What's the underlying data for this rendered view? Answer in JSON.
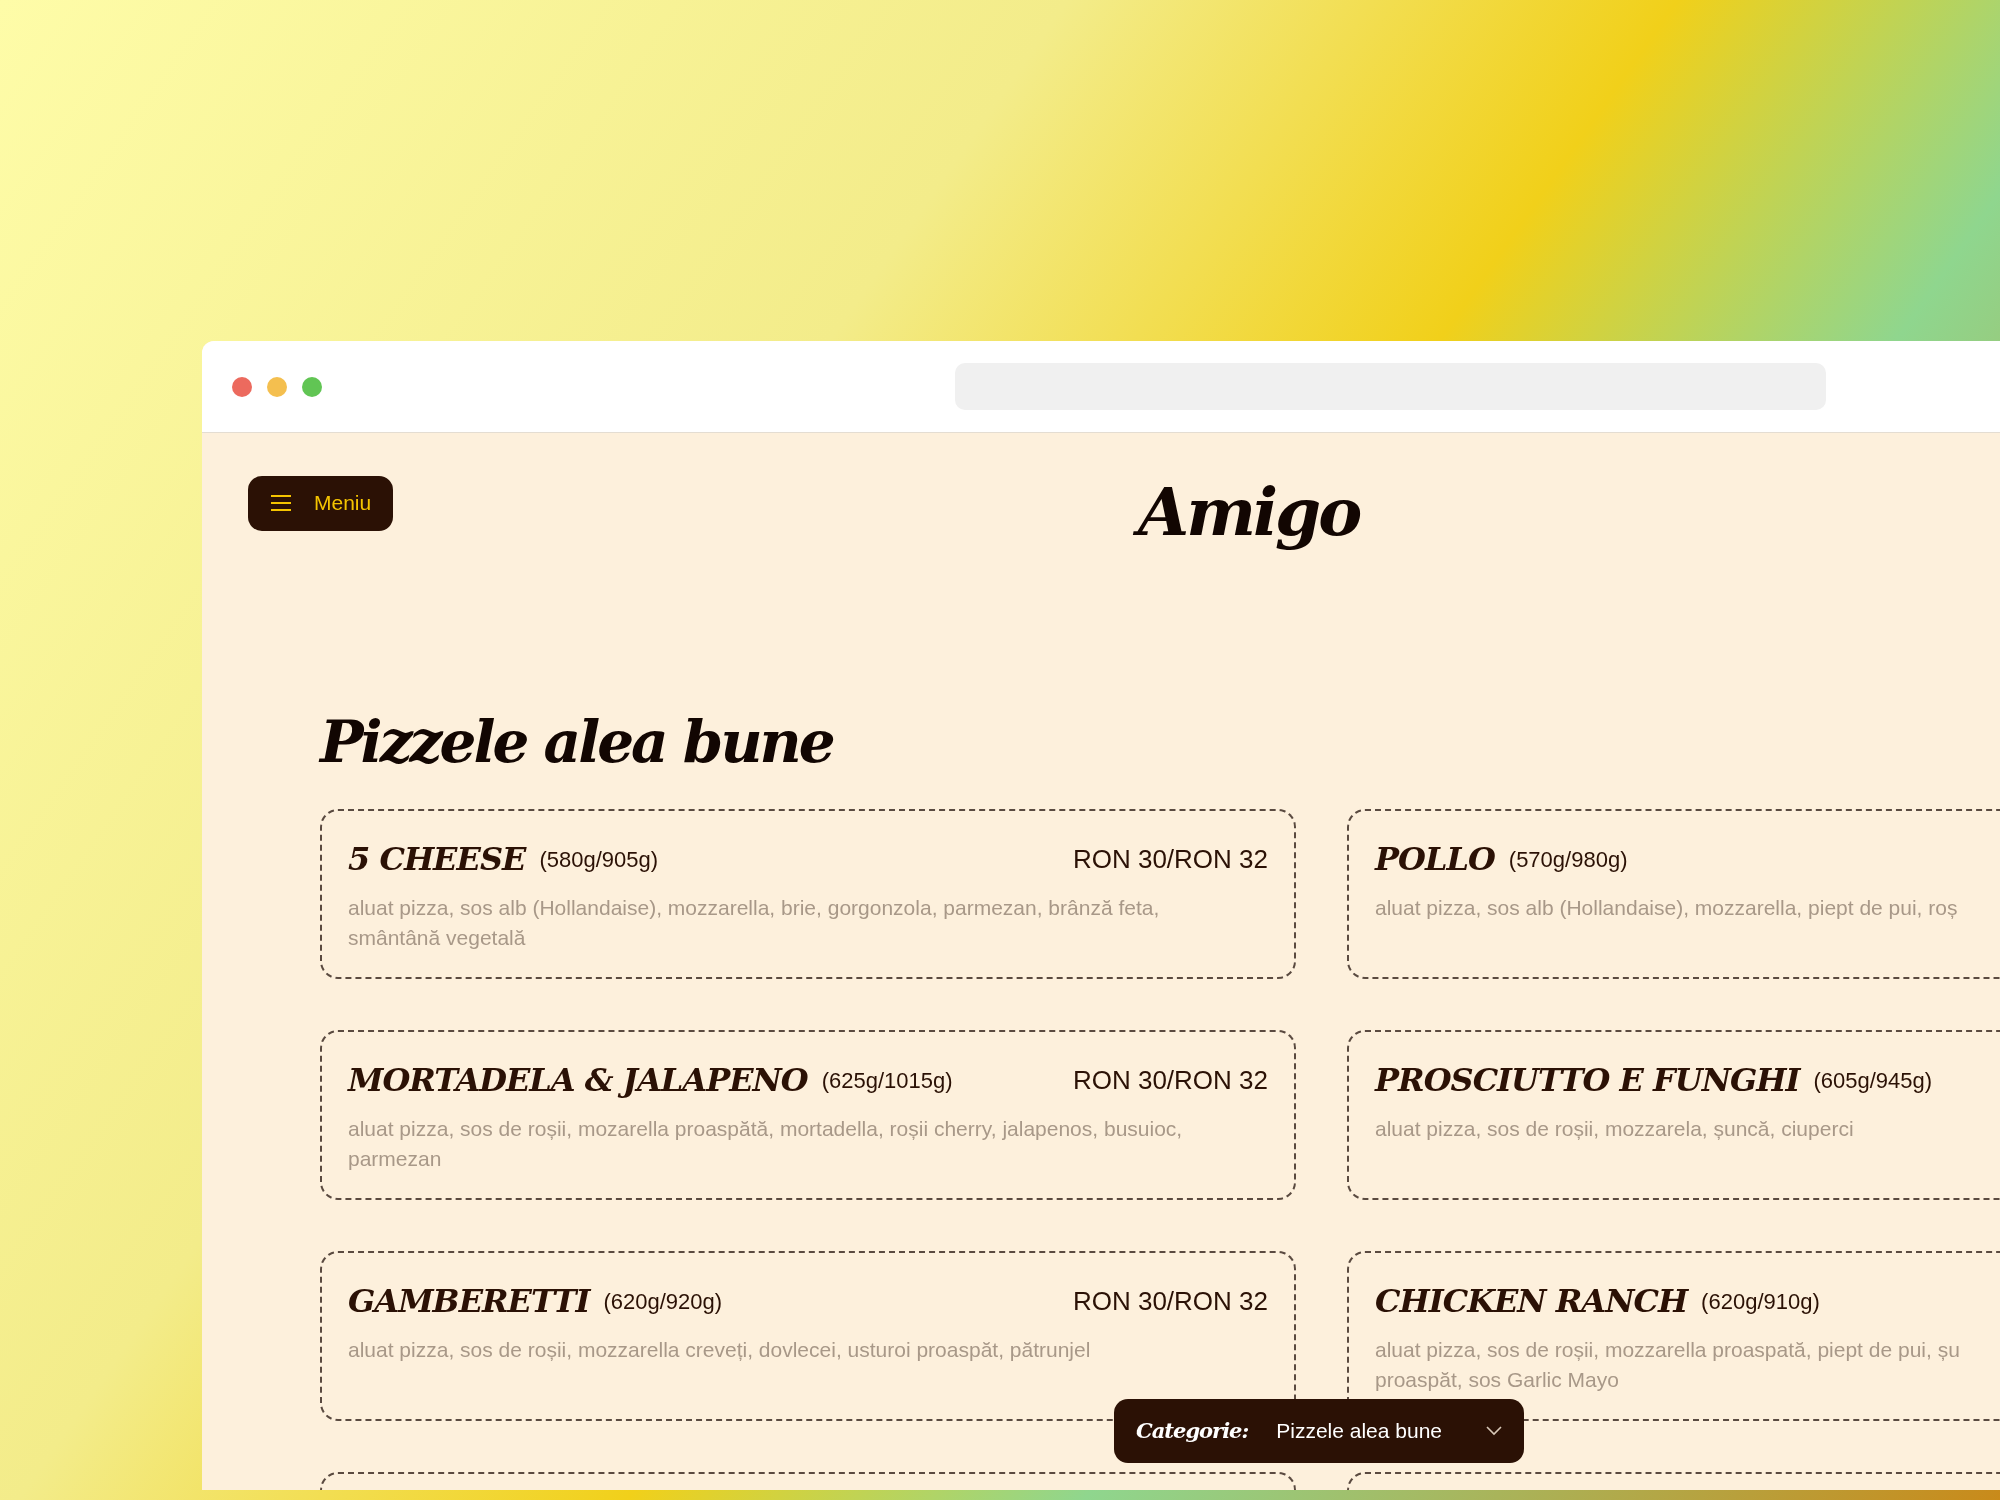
{
  "header": {
    "menu_button": {
      "label": "Meniu"
    },
    "logo": "Amigo"
  },
  "section": {
    "title": "Pizzele alea bune",
    "items": [
      {
        "name": "5 CHEESE",
        "weight": "(580g/905g)",
        "price": "RON 30/RON 32",
        "description_lines": [
          "aluat pizza, sos alb (Hollandaise), mozzarella, brie, gorgonzola, parmezan, brânză feta,",
          "smântână vegetală"
        ]
      },
      {
        "name": "POLLO",
        "weight": "(570g/980g)",
        "description_lines": [
          "aluat pizza, sos alb (Hollandaise), mozzarella, piept de pui, roș"
        ]
      },
      {
        "name": "MORTADELA & JALAPENO",
        "weight": "(625g/1015g)",
        "price": "RON 30/RON 32",
        "description_lines": [
          "aluat pizza, sos de roșii, mozarella proaspătă, mortadella, roșii cherry, jalapenos, busuioc,",
          "parmezan"
        ]
      },
      {
        "name": "PROSCIUTTO E FUNGHI",
        "weight": "(605g/945g)",
        "description_lines": [
          "aluat pizza, sos de roșii, mozzarela, șuncă, ciuperci"
        ]
      },
      {
        "name": "GAMBERETTI",
        "weight": "(620g/920g)",
        "price": "RON 30/RON 32",
        "description_lines": [
          "aluat pizza, sos de roșii, mozzarella creveți, dovlecei, usturoi proaspăt, pătrunjel"
        ]
      },
      {
        "name": "CHICKEN RANCH",
        "weight": "(620g/910g)",
        "description_lines": [
          "aluat pizza, sos de roșii, mozzarella proaspată, piept de pui, șu",
          "proaspăt, sos Garlic Mayo"
        ]
      }
    ]
  },
  "category_picker": {
    "label": "Categorie:",
    "value": "Pizzele alea bune"
  }
}
